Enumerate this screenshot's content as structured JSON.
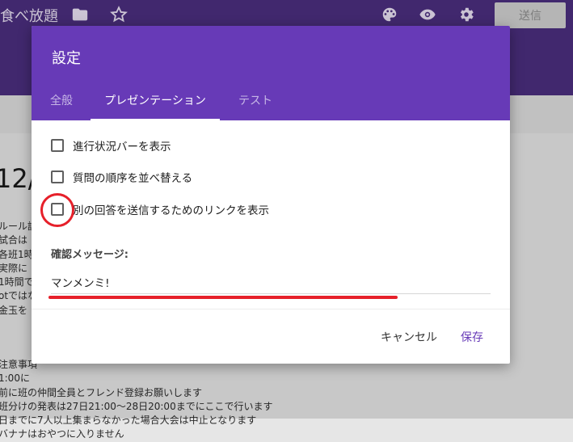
{
  "app": {
    "title": "食べ放題",
    "send_label": "送信",
    "background_big_text": "12/",
    "background_lines": [
      "ルール説",
      "試合は",
      "各班1時",
      "実際に",
      "1時間で",
      "otではな",
      "金玉を"
    ],
    "background_lines_bottom": [
      "注意事項",
      "1:00に",
      "前に班の仲間全員とフレンド登録お願いします",
      "班分けの発表は27日21:00〜28日20:00までにここで行います",
      "日までに7人以上集まらなかった場合大会は中止となります",
      "バナナはおやつに入りません"
    ]
  },
  "dialog": {
    "title": "設定",
    "tabs": {
      "general": "全般",
      "presentation": "プレゼンテーション",
      "test": "テスト"
    },
    "options": [
      "進行状況バーを表示",
      "質問の順序を並べ替える",
      "別の回答を送信するためのリンクを表示"
    ],
    "confirm_label": "確認メッセージ:",
    "confirm_value": "マンメンミ!",
    "cancel_label": "キャンセル",
    "save_label": "保存"
  },
  "colors": {
    "dialog_header": "#673ab7",
    "app_header": "#4a2e7e",
    "annotation": "#e6202a"
  }
}
